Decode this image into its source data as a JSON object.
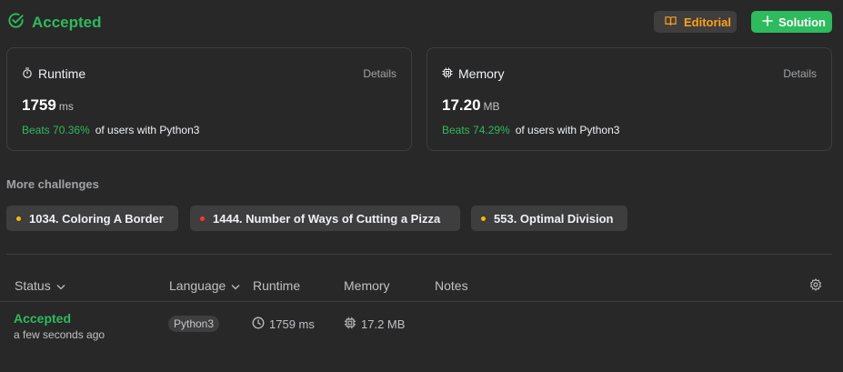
{
  "header": {
    "status": "Accepted",
    "editorial_label": "Editorial",
    "solution_label": "Solution"
  },
  "runtime_card": {
    "label": "Runtime",
    "details": "Details",
    "value": "1759",
    "unit": "ms",
    "beats": "Beats 70.36%",
    "beats_suffix": "of users with Python3"
  },
  "memory_card": {
    "label": "Memory",
    "details": "Details",
    "value": "17.20",
    "unit": "MB",
    "beats": "Beats 74.29%",
    "beats_suffix": "of users with Python3"
  },
  "more_challenges": {
    "title": "More challenges",
    "items": [
      {
        "label": "1034. Coloring A Border",
        "dot_color": "#ffb800"
      },
      {
        "label": "1444. Number of Ways of Cutting a Pizza",
        "dot_color": "#f63737"
      },
      {
        "label": "553. Optimal Division",
        "dot_color": "#ffb800"
      }
    ]
  },
  "submissions": {
    "headers": {
      "status": "Status",
      "language": "Language",
      "runtime": "Runtime",
      "memory": "Memory",
      "notes": "Notes"
    },
    "rows": [
      {
        "status": "Accepted",
        "time": "a few seconds ago",
        "language": "Python3",
        "runtime": "1759 ms",
        "memory": "17.2 MB"
      }
    ]
  },
  "colors": {
    "accent_green": "#2cbb5d",
    "accent_orange": "#ffa116",
    "background": "#282828"
  },
  "icons": [
    "check-circle-icon",
    "book-icon",
    "plus-icon",
    "stopwatch-icon",
    "chip-icon",
    "chevron-down-icon",
    "gear-icon",
    "clock-icon"
  ]
}
